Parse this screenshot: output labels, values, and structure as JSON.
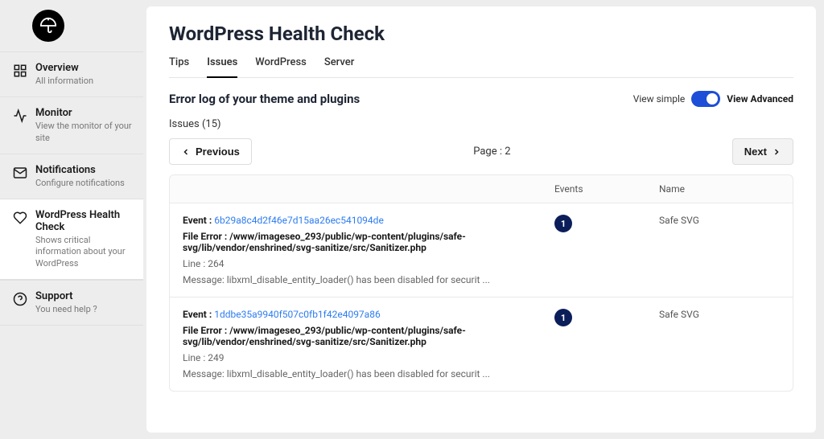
{
  "sidebar": {
    "items": [
      {
        "label": "Overview",
        "desc": "All information"
      },
      {
        "label": "Monitor",
        "desc": "View the monitor of your site"
      },
      {
        "label": "Notifications",
        "desc": "Configure notifications"
      },
      {
        "label": "WordPress Health Check",
        "desc": "Shows critical information about your WordPress"
      },
      {
        "label": "Support",
        "desc": "You need help ?"
      }
    ]
  },
  "page": {
    "title": "WordPress Health Check",
    "tabs": [
      "Tips",
      "Issues",
      "WordPress",
      "Server"
    ],
    "subheading": "Error log of your theme and plugins",
    "view_simple": "View simple",
    "view_advanced": "View Advanced",
    "issues_label": "Issues (15)",
    "prev": "Previous",
    "next": "Next",
    "page_indicator": "Page : 2",
    "columns": {
      "events": "Events",
      "name": "Name"
    }
  },
  "rows": [
    {
      "event_label": "Event :",
      "hash": "6b29a8c4d2f46e7d15aa26ec541094de",
      "file_label": "File Error :",
      "file": "/www/imageseo_293/public/wp-content/plugins/safe-svg/lib/vendor/enshrined/svg-sanitize/src/Sanitizer.php",
      "line": "Line : 264",
      "message": "Message: libxml_disable_entity_loader() has been disabled for securit ...",
      "events_count": "1",
      "name": "Safe SVG"
    },
    {
      "event_label": "Event :",
      "hash": "1ddbe35a9940f507c0fb1f42e4097a86",
      "file_label": "File Error :",
      "file": "/www/imageseo_293/public/wp-content/plugins/safe-svg/lib/vendor/enshrined/svg-sanitize/src/Sanitizer.php",
      "line": "Line : 249",
      "message": "Message: libxml_disable_entity_loader() has been disabled for securit ...",
      "events_count": "1",
      "name": "Safe SVG"
    }
  ]
}
